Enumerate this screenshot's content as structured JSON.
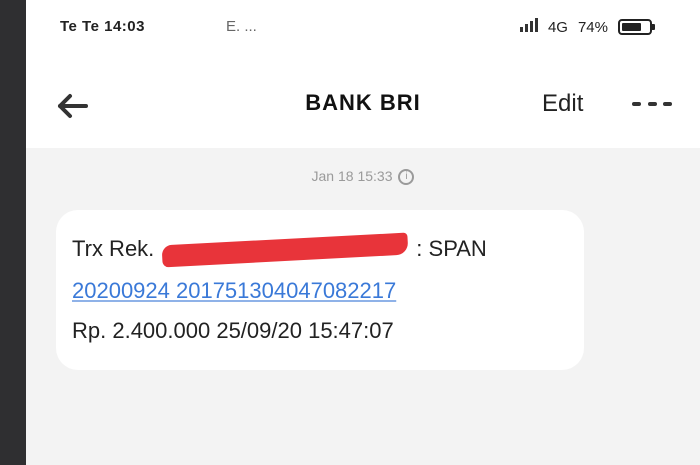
{
  "status_bar": {
    "time_carrier": "Te Te 14:03",
    "extra": "E. ...",
    "signal_text": "4G",
    "battery_percent_text": "74%",
    "battery_level": 0.74
  },
  "nav": {
    "title": "BANK BRI",
    "edit_label": "Edit"
  },
  "thread": {
    "timestamp": "Jan 18 15:33"
  },
  "message": {
    "prefix": "Trx Rek.",
    "after_redaction": ": SPAN",
    "reference_link": "20200924 201751304047082217",
    "amount_line": "Rp. 2.400.000 25/09/20 15:47:07"
  },
  "colors": {
    "redaction": "#e8343a",
    "link": "#3a79d8",
    "background": "#f3f3f3"
  },
  "icons": {
    "back": "arrow-left-icon",
    "more": "more-horizontal-icon",
    "info": "info-icon",
    "battery": "battery-icon",
    "signal": "signal-icon"
  }
}
